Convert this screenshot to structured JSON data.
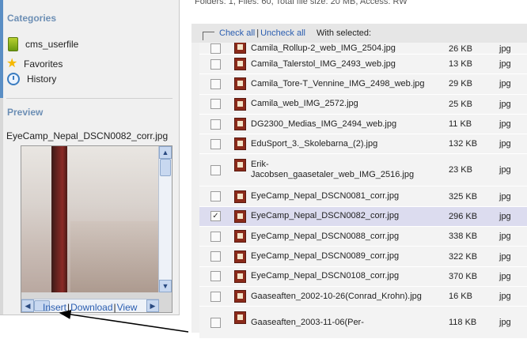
{
  "folder_info": "Folders: 1, Files: 60, Total file size: 20 MB, Access: RW",
  "sidebar": {
    "categories_title": "Categories",
    "categories": [
      {
        "label": "cms_userfile",
        "icon": "database-icon"
      },
      {
        "label": "Favorites",
        "icon": "star-icon"
      },
      {
        "label": "History",
        "icon": "clock-icon"
      }
    ],
    "preview_title": "Preview",
    "preview_filename": "EyeCamp_Nepal_DSCN0082_corr.jpg",
    "preview_links": {
      "insert": "Insert",
      "download": "Download",
      "view": "View"
    }
  },
  "toolbar": {
    "check_all": "Check all",
    "uncheck_all": "Uncheck all",
    "with_selected": "With selected:"
  },
  "files": [
    {
      "name": "Camila_Rollup-2_web_IMG_2504.jpg",
      "size": "26 KB",
      "type": "jpg",
      "checked": false,
      "partial": true
    },
    {
      "name": "Camila_Talerstol_IMG_2493_web.jpg",
      "size": "13 KB",
      "type": "jpg",
      "checked": false
    },
    {
      "name": "Camila_Tore-T_Vennine_IMG_2498_web.jpg",
      "size": "29 KB",
      "type": "jpg",
      "checked": false
    },
    {
      "name": "Camila_web_IMG_2572.jpg",
      "size": "25 KB",
      "type": "jpg",
      "checked": false
    },
    {
      "name": "DG2300_Medias_IMG_2494_web.jpg",
      "size": "11 KB",
      "type": "jpg",
      "checked": false
    },
    {
      "name": "EduSport_3._Skolebarna_(2).jpg",
      "size": "132 KB",
      "type": "jpg",
      "checked": false
    },
    {
      "name": "Erik-\nJacobsen_gaasetaler_web_IMG_2516.jpg",
      "size": "23 KB",
      "type": "jpg",
      "checked": false,
      "tall": true
    },
    {
      "name": "EyeCamp_Nepal_DSCN0081_corr.jpg",
      "size": "325 KB",
      "type": "jpg",
      "checked": false
    },
    {
      "name": "EyeCamp_Nepal_DSCN0082_corr.jpg",
      "size": "296 KB",
      "type": "jpg",
      "checked": true
    },
    {
      "name": "EyeCamp_Nepal_DSCN0088_corr.jpg",
      "size": "338 KB",
      "type": "jpg",
      "checked": false
    },
    {
      "name": "EyeCamp_Nepal_DSCN0089_corr.jpg",
      "size": "322 KB",
      "type": "jpg",
      "checked": false
    },
    {
      "name": "EyeCamp_Nepal_DSCN0108_corr.jpg",
      "size": "370 KB",
      "type": "jpg",
      "checked": false
    },
    {
      "name": "Gaaseaften_2002-10-26(Conrad_Krohn).jpg",
      "size": "16 KB",
      "type": "jpg",
      "checked": false
    },
    {
      "name": "Gaaseaften_2003-11-06(Per-",
      "size": "118 KB",
      "type": "jpg",
      "checked": false,
      "tall": true
    }
  ],
  "colors": {
    "accent": "#5a8ec4",
    "link": "#2a5db0",
    "selected_row": "#dcdcef"
  }
}
